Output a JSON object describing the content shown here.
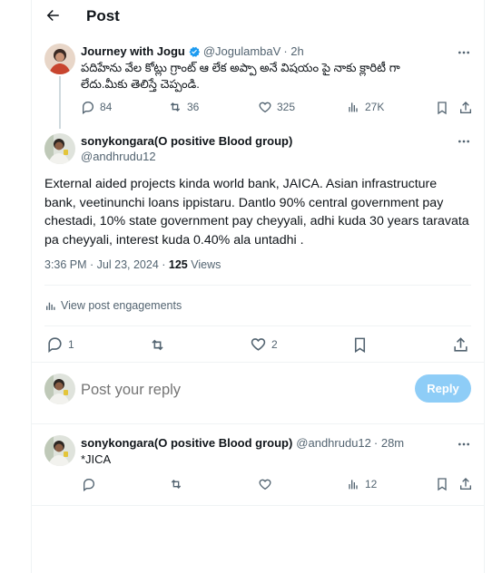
{
  "header": {
    "title": "Post"
  },
  "parent_post": {
    "author_name": "Journey with Jogu",
    "handle": "@JogulambaV",
    "time": "· 2h",
    "text_line1": "పదిహేను వేల కోట్లు గ్రాంట్ ఆ లేక అప్పా అనే విషయం పై నాకు క్లారిటీ గా",
    "text_line2": "లేదు.మీకు తెలిస్తే చెప్పండి.",
    "replies": "84",
    "reposts": "36",
    "likes": "325",
    "views": "27K"
  },
  "main_post": {
    "author_name": "sonykongara(O positive Blood group)",
    "handle": "@andhrudu12",
    "text": "External aided projects kinda world bank, JAICA. Asian infrastructure bank, veetinunchi loans ippistaru. Dantlo 90% central government pay chestadi, 10% state government pay cheyyali, adhi kuda 30 years taravata pa cheyyali, interest kuda  0.40% ala untadhi .",
    "timestamp": "3:36 PM · Jul 23, 2024 · ",
    "views_count": "125",
    "views_label": " Views",
    "engagements_label": "View post engagements",
    "replies": "1",
    "likes": "2"
  },
  "composer": {
    "placeholder": "Post your reply",
    "reply_button": "Reply"
  },
  "reply_post": {
    "author_name": "sonykongara(O positive Blood group)",
    "handle": "@andhrudu12",
    "time": "· 28m",
    "text": "*JICA",
    "views": "12"
  },
  "colors": {
    "text": "#0f1419",
    "secondary": "#536471",
    "accent": "#1d9bf0",
    "reply_button_disabled": "#8ecdf7",
    "divider": "#eff3f4"
  },
  "icons": [
    "back-arrow-icon",
    "verified-badge-icon",
    "more-icon",
    "reply-icon",
    "repost-icon",
    "like-icon",
    "views-icon",
    "bookmark-icon",
    "share-icon",
    "analytics-icon"
  ]
}
